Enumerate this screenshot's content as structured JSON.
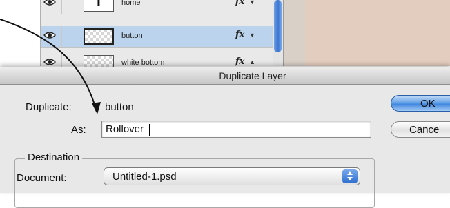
{
  "layers": [
    {
      "name": "home",
      "thumb_glyph": "T",
      "fx": "fx",
      "selected": false
    },
    {
      "name": "button",
      "thumb_glyph": "",
      "fx": "fx",
      "selected": true
    },
    {
      "name": "white bottom",
      "thumb_glyph": "",
      "fx": "fx",
      "selected": false
    }
  ],
  "dialog": {
    "title": "Duplicate Layer",
    "duplicate_label": "Duplicate:",
    "duplicate_value": "button",
    "as_label": "As:",
    "as_value": "Rollover",
    "destination_legend": "Destination",
    "document_label": "Document:",
    "document_value": "Untitled-1.psd",
    "ok_label": "OK",
    "cancel_label": "Cance"
  },
  "colors": {
    "selected_row": "#bcd3ee",
    "default_button": "#5b9be6",
    "canvas": "#e3cdbf"
  }
}
